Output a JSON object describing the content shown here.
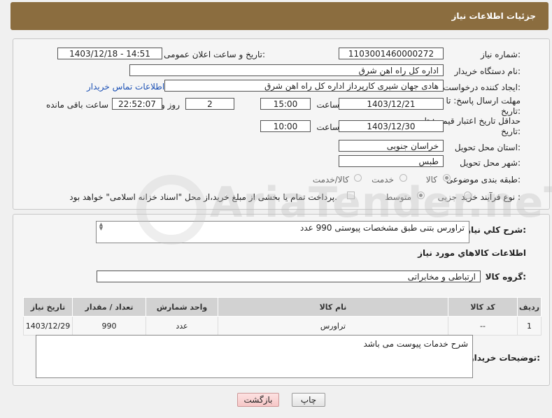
{
  "header": {
    "title": "جزئیات اطلاعات نیاز"
  },
  "form": {
    "need_number_label": "شماره نیاز:",
    "need_number": "1103001460000272",
    "announce_label": "تاریخ و ساعت اعلان عمومی:",
    "announce_value": "1403/12/18 - 14:51",
    "buyer_org_label": "نام دستگاه خریدار:",
    "buyer_org": "اداره کل راه اهن شرق",
    "creator_label": "ایجاد کننده درخواست:",
    "creator": "هادی جهان شیری کارپرداز اداره کل راه اهن شرق",
    "contact_link": "اطلاعات تماس خریدار",
    "deadline_label_1": "مهلت ارسال پاسخ: تا",
    "deadline_label_2": "تاریخ:",
    "deadline_date": "1403/12/21",
    "time_label": "ساعت",
    "deadline_time": "15:00",
    "days": "2",
    "days_label": "روز و",
    "remaining_time": "22:52:07",
    "remaining_label": "ساعت باقی مانده",
    "validity_label_1": "حداقل تاریخ اعتبار قیمت: تا",
    "validity_label_2": "تاریخ:",
    "validity_date": "1403/12/30",
    "validity_time": "10:00",
    "province_label": "استان محل تحویل:",
    "province": "خراسان جنوبی",
    "city_label": "شهر محل تحویل:",
    "city": "طبس",
    "category_label": "طبقه بندی موضوعی:",
    "category_options": [
      "کالا",
      "خدمت",
      "کالا/خدمت"
    ],
    "category_selected": "کالا",
    "process_label": "نوع فرآیند خرید :",
    "process_options": [
      "جزیی",
      "متوسط"
    ],
    "payment_note": "پرداخت تمام یا بخشی از مبلغ خرید،از محل \"اسناد خزانه اسلامی\" خواهد بود."
  },
  "details": {
    "description_label": "شرح کلي نياز:",
    "description": "تراورس بتنی طبق مشخصات پیوستی   990 عدد",
    "goods_info_title": "اطلاعات کالاهاي مورد نياز",
    "goods_group_label": "گروه کالا:",
    "goods_group": "ارتباطی و مخابراتی",
    "table": {
      "headers": [
        "رديف",
        "کد کالا",
        "نام کالا",
        "واحد شمارش",
        "تعداد / مقدار",
        "تاريخ نياز"
      ],
      "rows": [
        [
          "1",
          "--",
          "تراورس",
          "عدد",
          "990",
          "1403/12/29"
        ]
      ]
    },
    "buyer_notes_label": "توضیحات خریدار:",
    "buyer_notes": "شرح خدمات پیوست می باشد"
  },
  "buttons": {
    "print": "چاپ",
    "back": "بازگشت"
  },
  "watermark": {
    "text": "AriaTender.neT"
  }
}
